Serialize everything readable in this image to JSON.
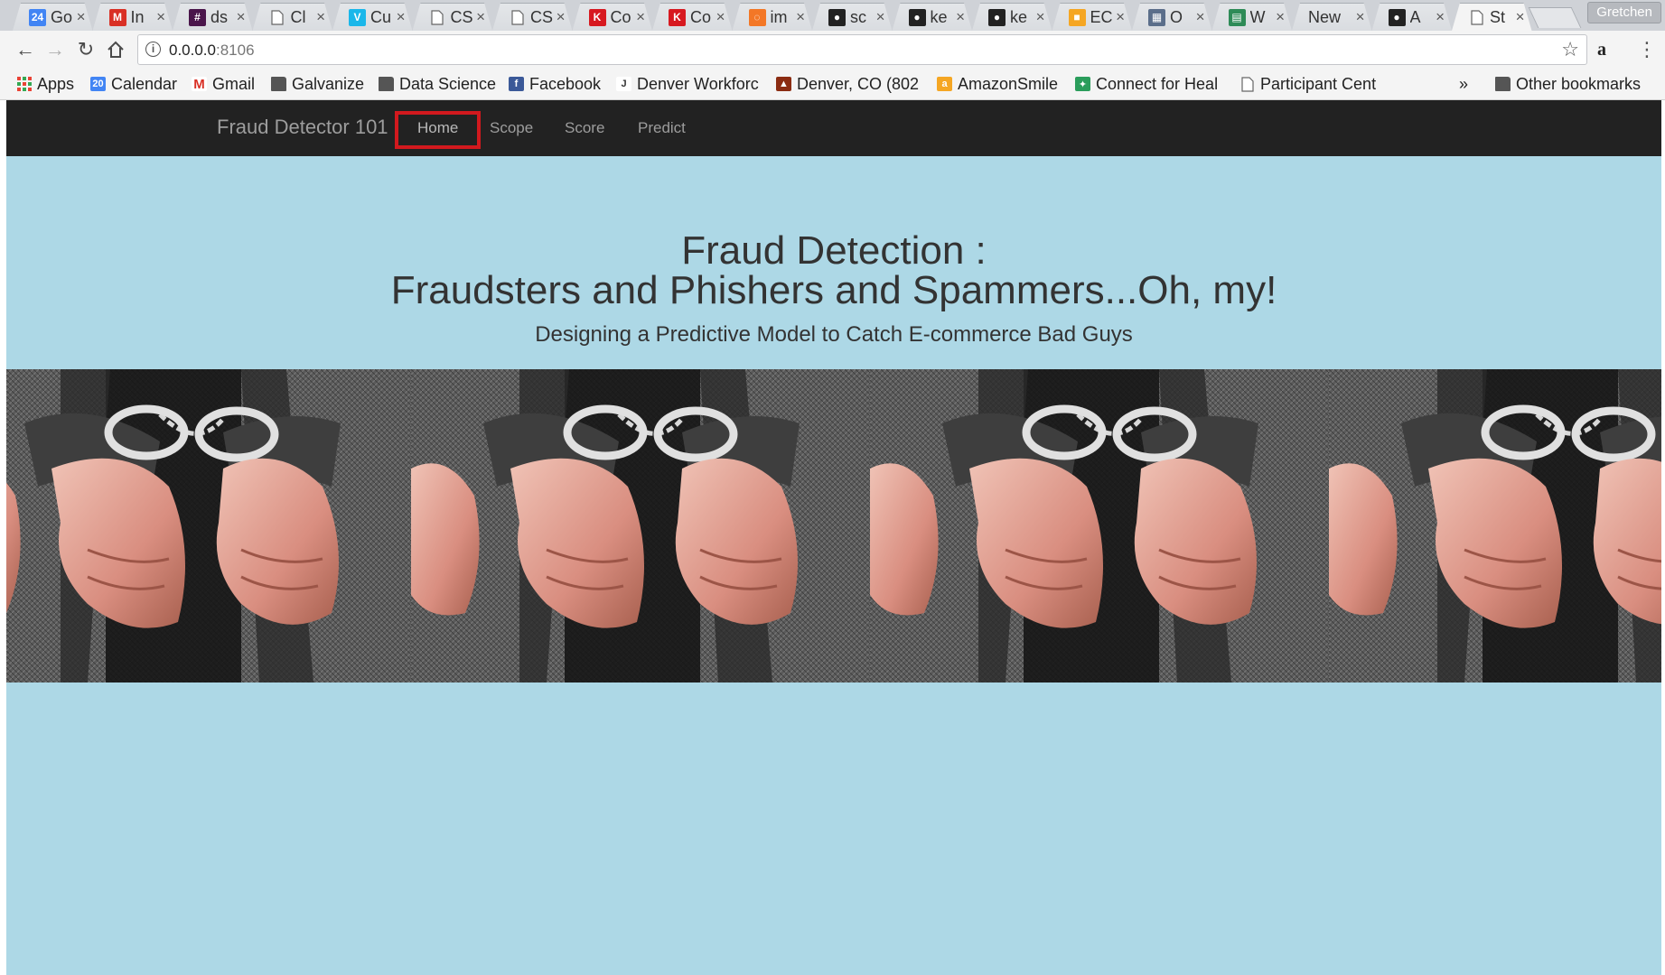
{
  "browser": {
    "tabs": [
      {
        "title": "Go",
        "icon": "calendar-tab-icon",
        "icon_text": "24",
        "icon_color": "#4285f4"
      },
      {
        "title": "In",
        "icon": "gmail-tab-icon",
        "icon_text": "M",
        "icon_color": "#d93025"
      },
      {
        "title": "ds",
        "icon": "slack-tab-icon",
        "icon_text": "#",
        "icon_color": "#4a154b"
      },
      {
        "title": "Cl",
        "icon": "document-tab-icon",
        "icon_text": "",
        "icon_color": ""
      },
      {
        "title": "Cu",
        "icon": "vimeo-tab-icon",
        "icon_text": "V",
        "icon_color": "#1ab7ea"
      },
      {
        "title": "CS",
        "icon": "document-tab-icon",
        "icon_text": "",
        "icon_color": ""
      },
      {
        "title": "CS",
        "icon": "document-tab-icon",
        "icon_text": "",
        "icon_color": ""
      },
      {
        "title": "Co",
        "icon": "kaggle-tab-icon",
        "icon_text": "K",
        "icon_color": "#d71920"
      },
      {
        "title": "Co",
        "icon": "kaggle-tab-icon",
        "icon_text": "K",
        "icon_color": "#d71920"
      },
      {
        "title": "im",
        "icon": "jupyter-tab-icon",
        "icon_text": "◌",
        "icon_color": "#f37726"
      },
      {
        "title": "sc",
        "icon": "github-tab-icon",
        "icon_text": "●",
        "icon_color": "#222222"
      },
      {
        "title": "ke",
        "icon": "github-tab-icon",
        "icon_text": "●",
        "icon_color": "#222222"
      },
      {
        "title": "ke",
        "icon": "github-tab-icon",
        "icon_text": "●",
        "icon_color": "#222222"
      },
      {
        "title": "EC",
        "icon": "aws-tab-icon",
        "icon_text": "■",
        "icon_color": "#f5a623"
      },
      {
        "title": "O",
        "icon": "building-tab-icon",
        "icon_text": "▦",
        "icon_color": "#5b6e8a"
      },
      {
        "title": "W",
        "icon": "spreadsheet-tab-icon",
        "icon_text": "▤",
        "icon_color": "#2e8b57"
      },
      {
        "title": "New",
        "icon": "",
        "icon_text": "",
        "icon_color": ""
      },
      {
        "title": "A",
        "icon": "github-tab-icon",
        "icon_text": "●",
        "icon_color": "#222222"
      },
      {
        "title": "St",
        "icon": "document-tab-icon",
        "icon_text": "",
        "icon_color": "",
        "active": true
      }
    ],
    "profile_name": "Gretchen",
    "url_host": "0.0.0.0",
    "url_port": ":8106",
    "bookmarks": [
      {
        "label": "Apps",
        "icon": "apps-grid-icon"
      },
      {
        "label": "Calendar",
        "icon": "calendar-icon"
      },
      {
        "label": "Gmail",
        "icon": "gmail-icon"
      },
      {
        "label": "Galvanize",
        "icon": "folder-icon"
      },
      {
        "label": "Data Science",
        "icon": "folder-icon"
      },
      {
        "label": "Facebook",
        "icon": "facebook-icon"
      },
      {
        "label": "Denver Workforc",
        "icon": "workforce-icon"
      },
      {
        "label": "Denver, CO (802",
        "icon": "weather-icon"
      },
      {
        "label": "AmazonSmile",
        "icon": "amazon-icon"
      },
      {
        "label": "Connect for Heal",
        "icon": "health-icon"
      },
      {
        "label": "Participant Cent",
        "icon": "document-icon"
      }
    ],
    "overflow_label": "»",
    "other_bookmarks": "Other bookmarks"
  },
  "site": {
    "brand": "Fraud Detector 101",
    "nav": [
      "Home",
      "Scope",
      "Score",
      "Predict"
    ],
    "active_nav": "Home",
    "hero_line1": "Fraud Detection :",
    "hero_line2": "Fraudsters and Phishers and Spammers...Oh, my!",
    "subtitle": "Designing a Predictive Model to Catch E-commerce Bad Guys",
    "banner_image": "handcuffed-hands-banner"
  },
  "colors": {
    "page_bg": "#add8e6",
    "navbar_bg": "#222222",
    "highlight": "#d2191e"
  }
}
